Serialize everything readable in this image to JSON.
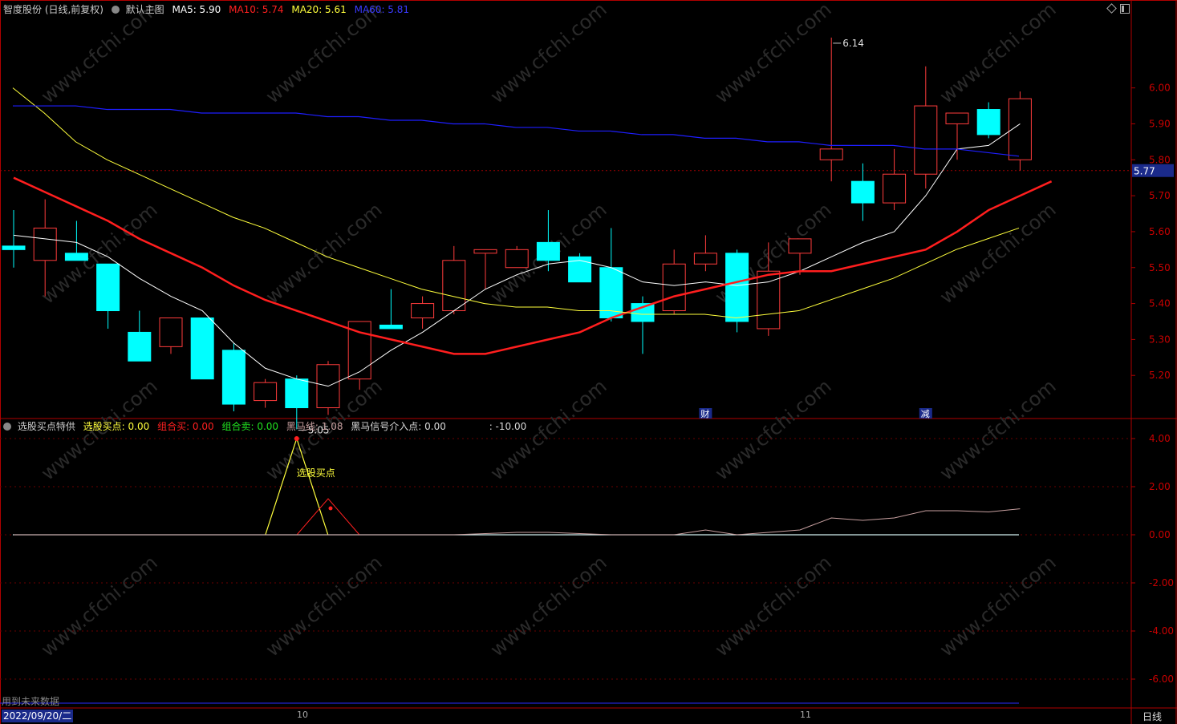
{
  "main_header": {
    "stock": "智度股份 (日线,前复权)",
    "template": "默认主图",
    "ma5": "MA5: 5.90",
    "ma10": "MA10: 5.74",
    "ma20": "MA20: 5.61",
    "ma60": "MA60: 5.81"
  },
  "sub_header": {
    "indicator": "选股买点特供",
    "buy": "选股买点: 0.00",
    "combo_buy": "组合买: 0.00",
    "combo_sell": "组合卖: 0.00",
    "dark_horse": "黑马线: 1.08",
    "dark_horse_signal": "黑马信号介入点: 0.00",
    "extra": ": -10.00"
  },
  "footer": {
    "date": "2022/09/20/二",
    "future_data": "用到未来数据",
    "period": "日线",
    "month_10": "10",
    "month_11": "11"
  },
  "colors": {
    "up": "#ff3c3c",
    "down": "#00ffff",
    "ma5": "#ffffff",
    "ma10": "#ff1e1e",
    "ma20": "#ffff3c",
    "ma60": "#1e1eff",
    "axis": "#b00000",
    "grid": "#6a0000",
    "watermark": "#2a2a2a"
  },
  "watermark": "www.cfchi.com",
  "chart_data": [
    {
      "type": "candlestick",
      "title": "智度股份 (日线,前复权)",
      "ylim": [
        5.08,
        6.2
      ],
      "yticks": [
        "6.00",
        "5.90",
        "5.80",
        "5.70",
        "5.60",
        "5.50",
        "5.40",
        "5.30",
        "5.20"
      ],
      "current_price": "5.77",
      "high_label": "6.14",
      "low_label": "5.05",
      "event_markers": [
        {
          "label": "财",
          "index": 22
        },
        {
          "label": "减",
          "index": 29
        }
      ],
      "candles": [
        {
          "o": 5.56,
          "h": 5.66,
          "l": 5.5,
          "c": 5.55
        },
        {
          "o": 5.52,
          "h": 5.69,
          "l": 5.42,
          "c": 5.61
        },
        {
          "o": 5.54,
          "h": 5.63,
          "l": 5.53,
          "c": 5.52
        },
        {
          "o": 5.51,
          "h": 5.51,
          "l": 5.33,
          "c": 5.38
        },
        {
          "o": 5.32,
          "h": 5.38,
          "l": 5.24,
          "c": 5.24
        },
        {
          "o": 5.28,
          "h": 5.36,
          "l": 5.26,
          "c": 5.36
        },
        {
          "o": 5.36,
          "h": 5.36,
          "l": 5.19,
          "c": 5.19
        },
        {
          "o": 5.27,
          "h": 5.29,
          "l": 5.1,
          "c": 5.12
        },
        {
          "o": 5.13,
          "h": 5.19,
          "l": 5.11,
          "c": 5.18
        },
        {
          "o": 5.19,
          "h": 5.2,
          "l": 5.05,
          "c": 5.11
        },
        {
          "o": 5.11,
          "h": 5.24,
          "l": 5.09,
          "c": 5.23
        },
        {
          "o": 5.19,
          "h": 5.35,
          "l": 5.16,
          "c": 5.35
        },
        {
          "o": 5.34,
          "h": 5.44,
          "l": 5.33,
          "c": 5.33
        },
        {
          "o": 5.36,
          "h": 5.42,
          "l": 5.33,
          "c": 5.4
        },
        {
          "o": 5.38,
          "h": 5.56,
          "l": 5.37,
          "c": 5.52
        },
        {
          "o": 5.54,
          "h": 5.55,
          "l": 5.44,
          "c": 5.55
        },
        {
          "o": 5.5,
          "h": 5.56,
          "l": 5.5,
          "c": 5.55
        },
        {
          "o": 5.57,
          "h": 5.66,
          "l": 5.49,
          "c": 5.52
        },
        {
          "o": 5.53,
          "h": 5.54,
          "l": 5.46,
          "c": 5.46
        },
        {
          "o": 5.5,
          "h": 5.61,
          "l": 5.35,
          "c": 5.36
        },
        {
          "o": 5.4,
          "h": 5.42,
          "l": 5.26,
          "c": 5.35
        },
        {
          "o": 5.38,
          "h": 5.55,
          "l": 5.37,
          "c": 5.51
        },
        {
          "o": 5.51,
          "h": 5.59,
          "l": 5.49,
          "c": 5.54
        },
        {
          "o": 5.54,
          "h": 5.55,
          "l": 5.32,
          "c": 5.35
        },
        {
          "o": 5.33,
          "h": 5.57,
          "l": 5.31,
          "c": 5.49
        },
        {
          "o": 5.54,
          "h": 5.58,
          "l": 5.48,
          "c": 5.58
        },
        {
          "o": 5.8,
          "h": 6.14,
          "l": 5.74,
          "c": 5.83
        },
        {
          "o": 5.74,
          "h": 5.79,
          "l": 5.63,
          "c": 5.68
        },
        {
          "o": 5.68,
          "h": 5.83,
          "l": 5.66,
          "c": 5.76
        },
        {
          "o": 5.76,
          "h": 6.06,
          "l": 5.72,
          "c": 5.95
        },
        {
          "o": 5.9,
          "h": 5.93,
          "l": 5.8,
          "c": 5.93
        },
        {
          "o": 5.94,
          "h": 5.96,
          "l": 5.86,
          "c": 5.87
        },
        {
          "o": 5.8,
          "h": 5.99,
          "l": 5.77,
          "c": 5.97
        }
      ],
      "series": [
        {
          "name": "MA5",
          "values": [
            5.59,
            5.58,
            5.57,
            5.53,
            5.47,
            5.42,
            5.38,
            5.29,
            5.22,
            5.19,
            5.17,
            5.21,
            5.27,
            5.32,
            5.38,
            5.44,
            5.48,
            5.51,
            5.52,
            5.5,
            5.46,
            5.45,
            5.46,
            5.45,
            5.46,
            5.49,
            5.53,
            5.57,
            5.6,
            5.7,
            5.83,
            5.84,
            5.9
          ]
        },
        {
          "name": "MA10",
          "values": [
            5.75,
            5.71,
            5.67,
            5.63,
            5.58,
            5.54,
            5.5,
            5.45,
            5.41,
            5.38,
            5.35,
            5.32,
            5.3,
            5.28,
            5.26,
            5.26,
            5.28,
            5.3,
            5.32,
            5.36,
            5.39,
            5.42,
            5.44,
            5.46,
            5.48,
            5.49,
            5.49,
            5.51,
            5.53,
            5.55,
            5.6,
            5.66,
            5.7,
            5.74
          ]
        },
        {
          "name": "MA20",
          "values": [
            6.0,
            5.93,
            5.85,
            5.8,
            5.76,
            5.72,
            5.68,
            5.64,
            5.61,
            5.57,
            5.53,
            5.5,
            5.47,
            5.44,
            5.42,
            5.4,
            5.39,
            5.39,
            5.38,
            5.38,
            5.37,
            5.37,
            5.37,
            5.36,
            5.37,
            5.38,
            5.41,
            5.44,
            5.47,
            5.51,
            5.55,
            5.58,
            5.61
          ]
        },
        {
          "name": "MA60",
          "values": [
            5.95,
            5.95,
            5.95,
            5.94,
            5.94,
            5.94,
            5.93,
            5.93,
            5.93,
            5.93,
            5.92,
            5.92,
            5.91,
            5.91,
            5.9,
            5.9,
            5.89,
            5.89,
            5.88,
            5.88,
            5.87,
            5.87,
            5.86,
            5.86,
            5.85,
            5.85,
            5.84,
            5.84,
            5.84,
            5.83,
            5.83,
            5.82,
            5.81
          ]
        }
      ]
    },
    {
      "type": "line",
      "title": "选股买点特供",
      "ylim": [
        -7.0,
        4.5
      ],
      "yticks": [
        "4.00",
        "2.00",
        "0.00",
        "-2.00",
        "-4.00",
        "-6.00"
      ],
      "annotations": [
        {
          "text": "选股买点",
          "index": 9
        }
      ],
      "series": [
        {
          "name": "选股买点",
          "values": [
            0,
            0,
            0,
            0,
            0,
            0,
            0,
            0,
            0,
            4,
            0,
            0,
            0,
            0,
            0,
            0,
            0,
            0,
            0,
            0,
            0,
            0,
            0,
            0,
            0,
            0,
            0,
            0,
            0,
            0,
            0,
            0,
            0
          ]
        },
        {
          "name": "组合买",
          "values": [
            0,
            0,
            0,
            0,
            0,
            0,
            0,
            0,
            0,
            0,
            1.5,
            0,
            0,
            0,
            0,
            0,
            0,
            0,
            0,
            0,
            0,
            0,
            0,
            0,
            0,
            0,
            0,
            0,
            0,
            0,
            0,
            0,
            0
          ]
        },
        {
          "name": "黑马线",
          "values": [
            0,
            0,
            0,
            0,
            0,
            0,
            0,
            0,
            0,
            0,
            0,
            0,
            0,
            0,
            0,
            0.05,
            0.1,
            0.1,
            0.05,
            0,
            0,
            0,
            0.2,
            0,
            0.1,
            0.2,
            0.7,
            0.6,
            0.7,
            1.0,
            1.0,
            0.95,
            1.08
          ]
        },
        {
          "name": "黑马信号介入点",
          "values": [
            0,
            0,
            0,
            0,
            0,
            0,
            0,
            0,
            0,
            0,
            0,
            0,
            0,
            0,
            0,
            0,
            0,
            0,
            0,
            0,
            0,
            0,
            0,
            0,
            0,
            0,
            0,
            0,
            0,
            0,
            0,
            0,
            0
          ]
        }
      ]
    }
  ]
}
